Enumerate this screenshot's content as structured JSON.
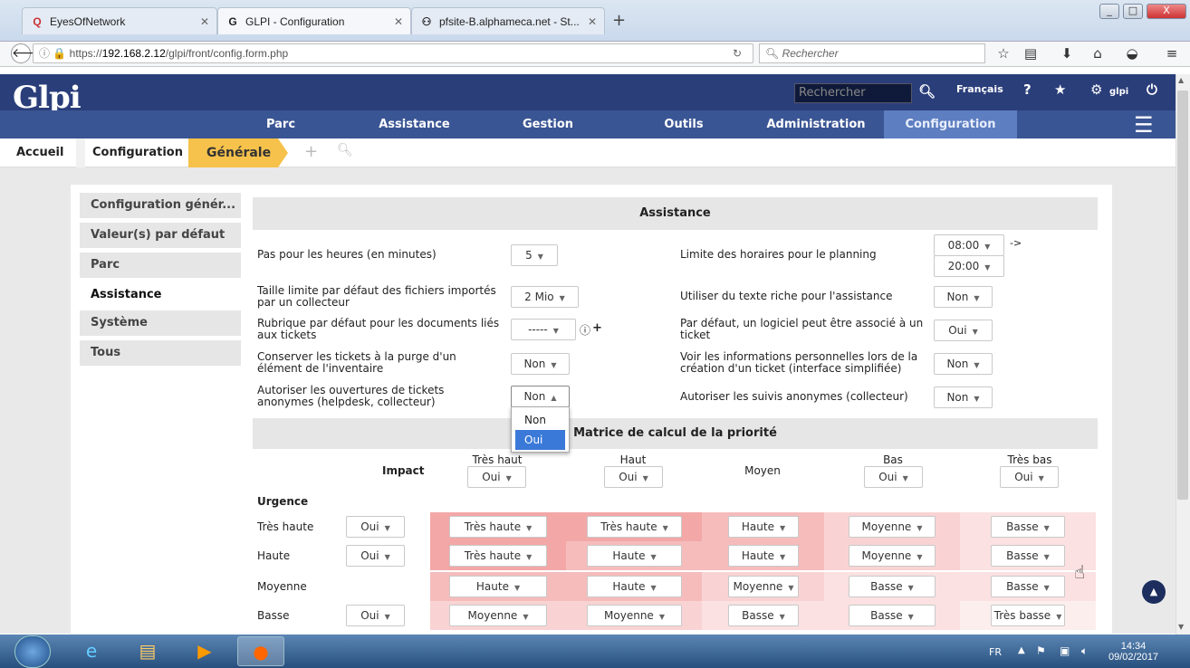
{
  "browser": {
    "tabs": [
      {
        "title": "EyesOfNetwork",
        "icon": "search-icon"
      },
      {
        "title": "GLPI - Configuration",
        "icon": "glpi-icon"
      },
      {
        "title": "pfsite-B.alphameca.net - St...",
        "icon": "pf-icon"
      }
    ],
    "new_tab": "+",
    "url_prefix": "https://",
    "url_host": "192.168.2.12",
    "url_path": "/glpi/front/config.form.php",
    "search_placeholder": "Rechercher",
    "window_buttons": [
      "_",
      "□",
      "X"
    ]
  },
  "glpi": {
    "logo": "Glpi",
    "search_placeholder": "Rechercher",
    "language": "Français",
    "user": "glpi",
    "menu": [
      "Parc",
      "Assistance",
      "Gestion",
      "Outils",
      "Administration",
      "Configuration"
    ],
    "active_menu": "Configuration",
    "breadcrumb": {
      "home": "Accueil",
      "section": "Configuration",
      "current": "Générale"
    }
  },
  "sidebar": {
    "items": [
      "Configuration génér...",
      "Valeur(s) par défaut",
      "Parc",
      "Assistance",
      "Système",
      "Tous"
    ],
    "active": "Assistance"
  },
  "assistance": {
    "title": "Assistance",
    "rows": [
      {
        "left_label": "Pas pour les heures (en minutes)",
        "left_value": "5",
        "right_label": "Limite des horaires pour le planning",
        "right_value": "08:00",
        "right_value2": "20:00",
        "right_suffix": "->"
      },
      {
        "left_label": "Taille limite par défaut des fichiers importés par un collecteur",
        "left_value": "2 Mio",
        "right_label": "Utiliser du texte riche pour l'assistance",
        "right_value": "Non"
      },
      {
        "left_label": "Rubrique par défaut pour les documents liés aux tickets",
        "left_value": "-----",
        "right_label": "Par défaut, un logiciel peut être associé à un ticket",
        "right_value": "Oui"
      },
      {
        "left_label": "Conserver les tickets à la purge d'un élément de l'inventaire",
        "left_value": "Non",
        "right_label": "Voir les informations personnelles lors de la création d'un ticket (interface simplifiée)",
        "right_value": "Non"
      },
      {
        "left_label": "Autoriser les ouvertures de tickets anonymes (helpdesk, collecteur)",
        "left_value": "Non",
        "right_label": "Autoriser les suivis anonymes (collecteur)",
        "right_value": "Non"
      }
    ],
    "dropdown_options": [
      "Non",
      "Oui"
    ],
    "dropdown_highlight": "Oui"
  },
  "matrix": {
    "title": "Matrice de calcul de la priorité",
    "impact_label": "Impact",
    "urgence_label": "Urgence",
    "impacts": [
      {
        "name": "Très haut",
        "value": "Oui"
      },
      {
        "name": "Haut",
        "value": "Oui"
      },
      {
        "name": "Moyen",
        "value": ""
      },
      {
        "name": "Bas",
        "value": "Oui"
      },
      {
        "name": "Très bas",
        "value": "Oui"
      }
    ],
    "rows": [
      {
        "name": "Très haute",
        "value": "Oui",
        "cells": [
          "Très haute",
          "Très haute",
          "Haute",
          "Moyenne",
          "Basse"
        ]
      },
      {
        "name": "Haute",
        "value": "Oui",
        "cells": [
          "Très haute",
          "Haute",
          "Haute",
          "Moyenne",
          "Basse"
        ]
      },
      {
        "name": "Moyenne",
        "value": "",
        "cells": [
          "Haute",
          "Haute",
          "Moyenne",
          "Basse",
          "Basse"
        ]
      },
      {
        "name": "Basse",
        "value": "Oui",
        "cells": [
          "Moyenne",
          "Moyenne",
          "Basse",
          "Basse",
          "Très basse"
        ]
      }
    ],
    "colors": {
      "tres_haute": "#f3a7a7",
      "haute": "#f6bcbc",
      "moyenne": "#f9d3d3",
      "basse": "#fbe1e1",
      "tres_basse": "#fdeeee"
    }
  },
  "taskbar": {
    "lang": "FR",
    "time": "14:34",
    "date": "09/02/2017"
  }
}
